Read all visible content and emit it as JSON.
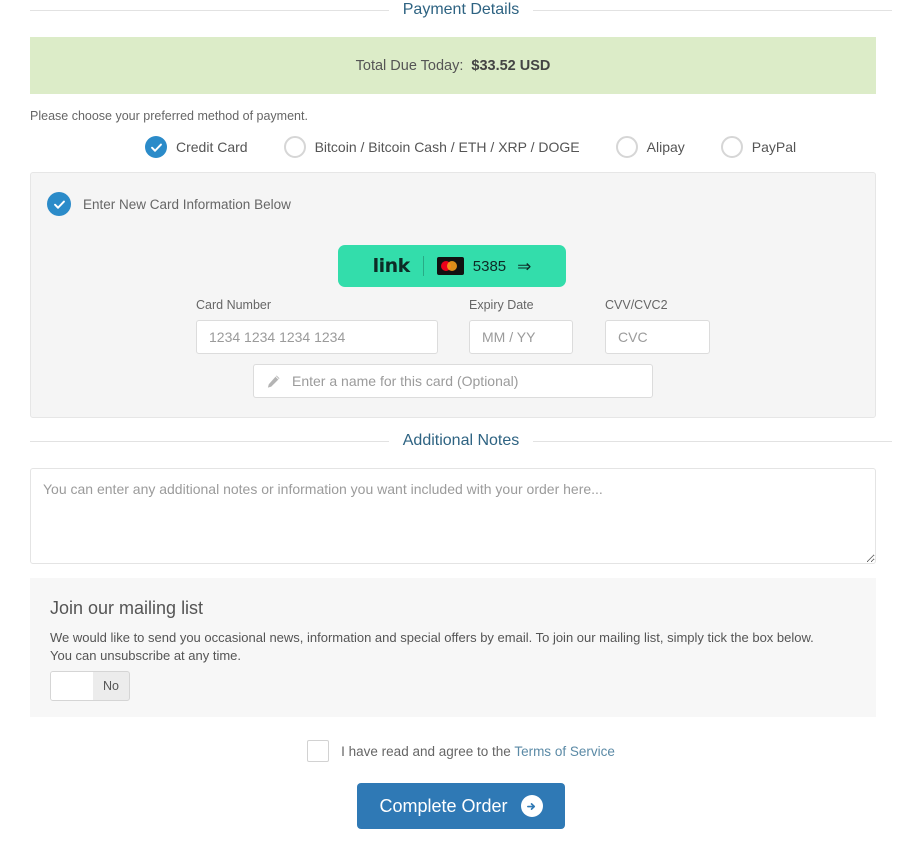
{
  "sections": {
    "payment_details_title": "Payment Details",
    "additional_notes_title": "Additional Notes"
  },
  "total": {
    "label": "Total Due Today:",
    "amount": "$33.52 USD",
    "banner_color": "#dcecc8"
  },
  "payment_methods": {
    "prompt": "Please choose your preferred method of payment.",
    "selected": "Credit Card",
    "options": [
      {
        "label": "Credit Card",
        "selected": true
      },
      {
        "label": "Bitcoin / Bitcoin Cash / ETH / XRP / DOGE",
        "selected": false
      },
      {
        "label": "Alipay",
        "selected": false
      },
      {
        "label": "PayPal",
        "selected": false
      }
    ],
    "accent_color": "#2b8bc9"
  },
  "card_panel": {
    "header_label": "Enter New Card Information Below",
    "link_badge": {
      "wordmark": "link",
      "brand": "mastercard",
      "last4": "5385",
      "arrow": "⇒",
      "background": "#33ddab"
    },
    "fields": {
      "card_number_label": "Card Number",
      "card_number_placeholder": "1234 1234 1234 1234",
      "card_number_value": "",
      "expiry_label": "Expiry Date",
      "expiry_placeholder": "MM / YY",
      "expiry_value": "",
      "cvv_label": "CVV/CVC2",
      "cvv_placeholder": "CVC",
      "cvv_value": "",
      "card_name_placeholder": "Enter a name for this card (Optional)",
      "card_name_value": ""
    }
  },
  "notes": {
    "placeholder": "You can enter any additional notes or information you want included with your order here...",
    "value": ""
  },
  "mailing_list": {
    "title": "Join our mailing list",
    "description": "We would like to send you occasional news, information and special offers by email. To join our mailing list, simply tick the box below. You can unsubscribe at any time.",
    "toggle_state": "No"
  },
  "terms": {
    "text_before": "I have read and agree to the",
    "link_label": "Terms of Service",
    "checked": false,
    "link_color": "#5b8aa6"
  },
  "submit": {
    "label": "Complete Order",
    "color": "#2f79b5"
  }
}
